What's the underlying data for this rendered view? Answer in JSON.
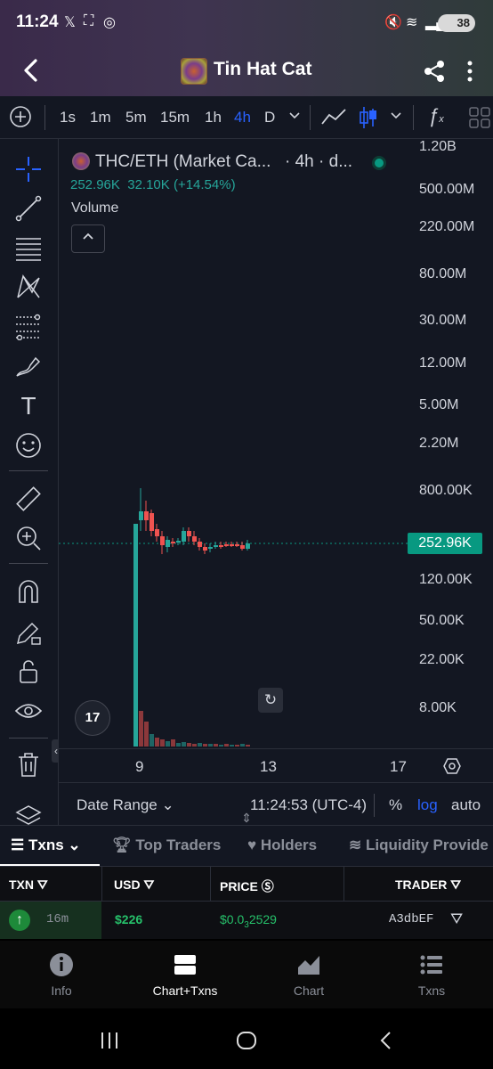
{
  "status_bar": {
    "time": "11:24",
    "battery": "38",
    "icons": [
      "x-logo-icon",
      "screenshot-icon",
      "instagram-icon",
      "mute-icon",
      "wifi-icon",
      "signal-icon",
      "battery-icon"
    ]
  },
  "header": {
    "title": "Tin Hat Cat",
    "back_icon": "back-arrow-icon",
    "share_icon": "share-icon",
    "more_icon": "more-vertical-icon"
  },
  "toolbar": {
    "intervals": [
      "1s",
      "1m",
      "5m",
      "15m",
      "1h",
      "4h",
      "D"
    ],
    "active_interval": "4h"
  },
  "chart": {
    "legend_title": "THC/ETH (Market Ca...",
    "legend_interval": "· 4h · d...",
    "legend_value": "252.96K",
    "legend_change": "32.10K (+14.54%)",
    "volume_label": "Volume",
    "collapse_label": "^",
    "current_price": "252.96K",
    "price_labels": [
      "1.20B",
      "500.00M",
      "220.00M",
      "80.00M",
      "30.00M",
      "12.00M",
      "5.00M",
      "2.20M",
      "800.00K",
      "120.00K",
      "50.00K",
      "22.00K",
      "8.00K"
    ],
    "time_labels": [
      "9",
      "13",
      "17"
    ],
    "tv_logo": "17",
    "up_color": "#26a69a",
    "down_color": "#ef5350"
  },
  "chart_data": {
    "type": "candlestick",
    "title": "THC/ETH (Market Ca...",
    "y_scale": "log",
    "yticks": [
      "1.20B",
      "500.00M",
      "220.00M",
      "80.00M",
      "30.00M",
      "12.00M",
      "5.00M",
      "2.20M",
      "800.00K",
      "120.00K",
      "50.00K",
      "22.00K",
      "8.00K"
    ],
    "xticks": [
      "9",
      "13",
      "17"
    ],
    "last_value": "252.96K",
    "change": "32.10K (+14.54%)"
  },
  "range_bar": {
    "date_range": "Date Range",
    "clock": "11:24:53 (UTC-4)",
    "percent": "%",
    "log": "log",
    "auto": "auto"
  },
  "tabs": {
    "txns": "Txns",
    "top_traders": "Top Traders",
    "holders": "Holders",
    "liquidity": "Liquidity Provide"
  },
  "table": {
    "headers": {
      "txn": "TXN",
      "usd": "USD",
      "price": "PRICE",
      "trader": "TRADER"
    },
    "rows": [
      {
        "age": "16m",
        "usd": "$226",
        "price_prefix": "$0.0",
        "price_sub": "3",
        "price_rest": "2529",
        "trader": "A3dbEF"
      }
    ]
  },
  "bottom_nav": {
    "items": [
      "Info",
      "Chart+Txns",
      "Chart",
      "Txns"
    ],
    "active": "Chart+Txns"
  }
}
